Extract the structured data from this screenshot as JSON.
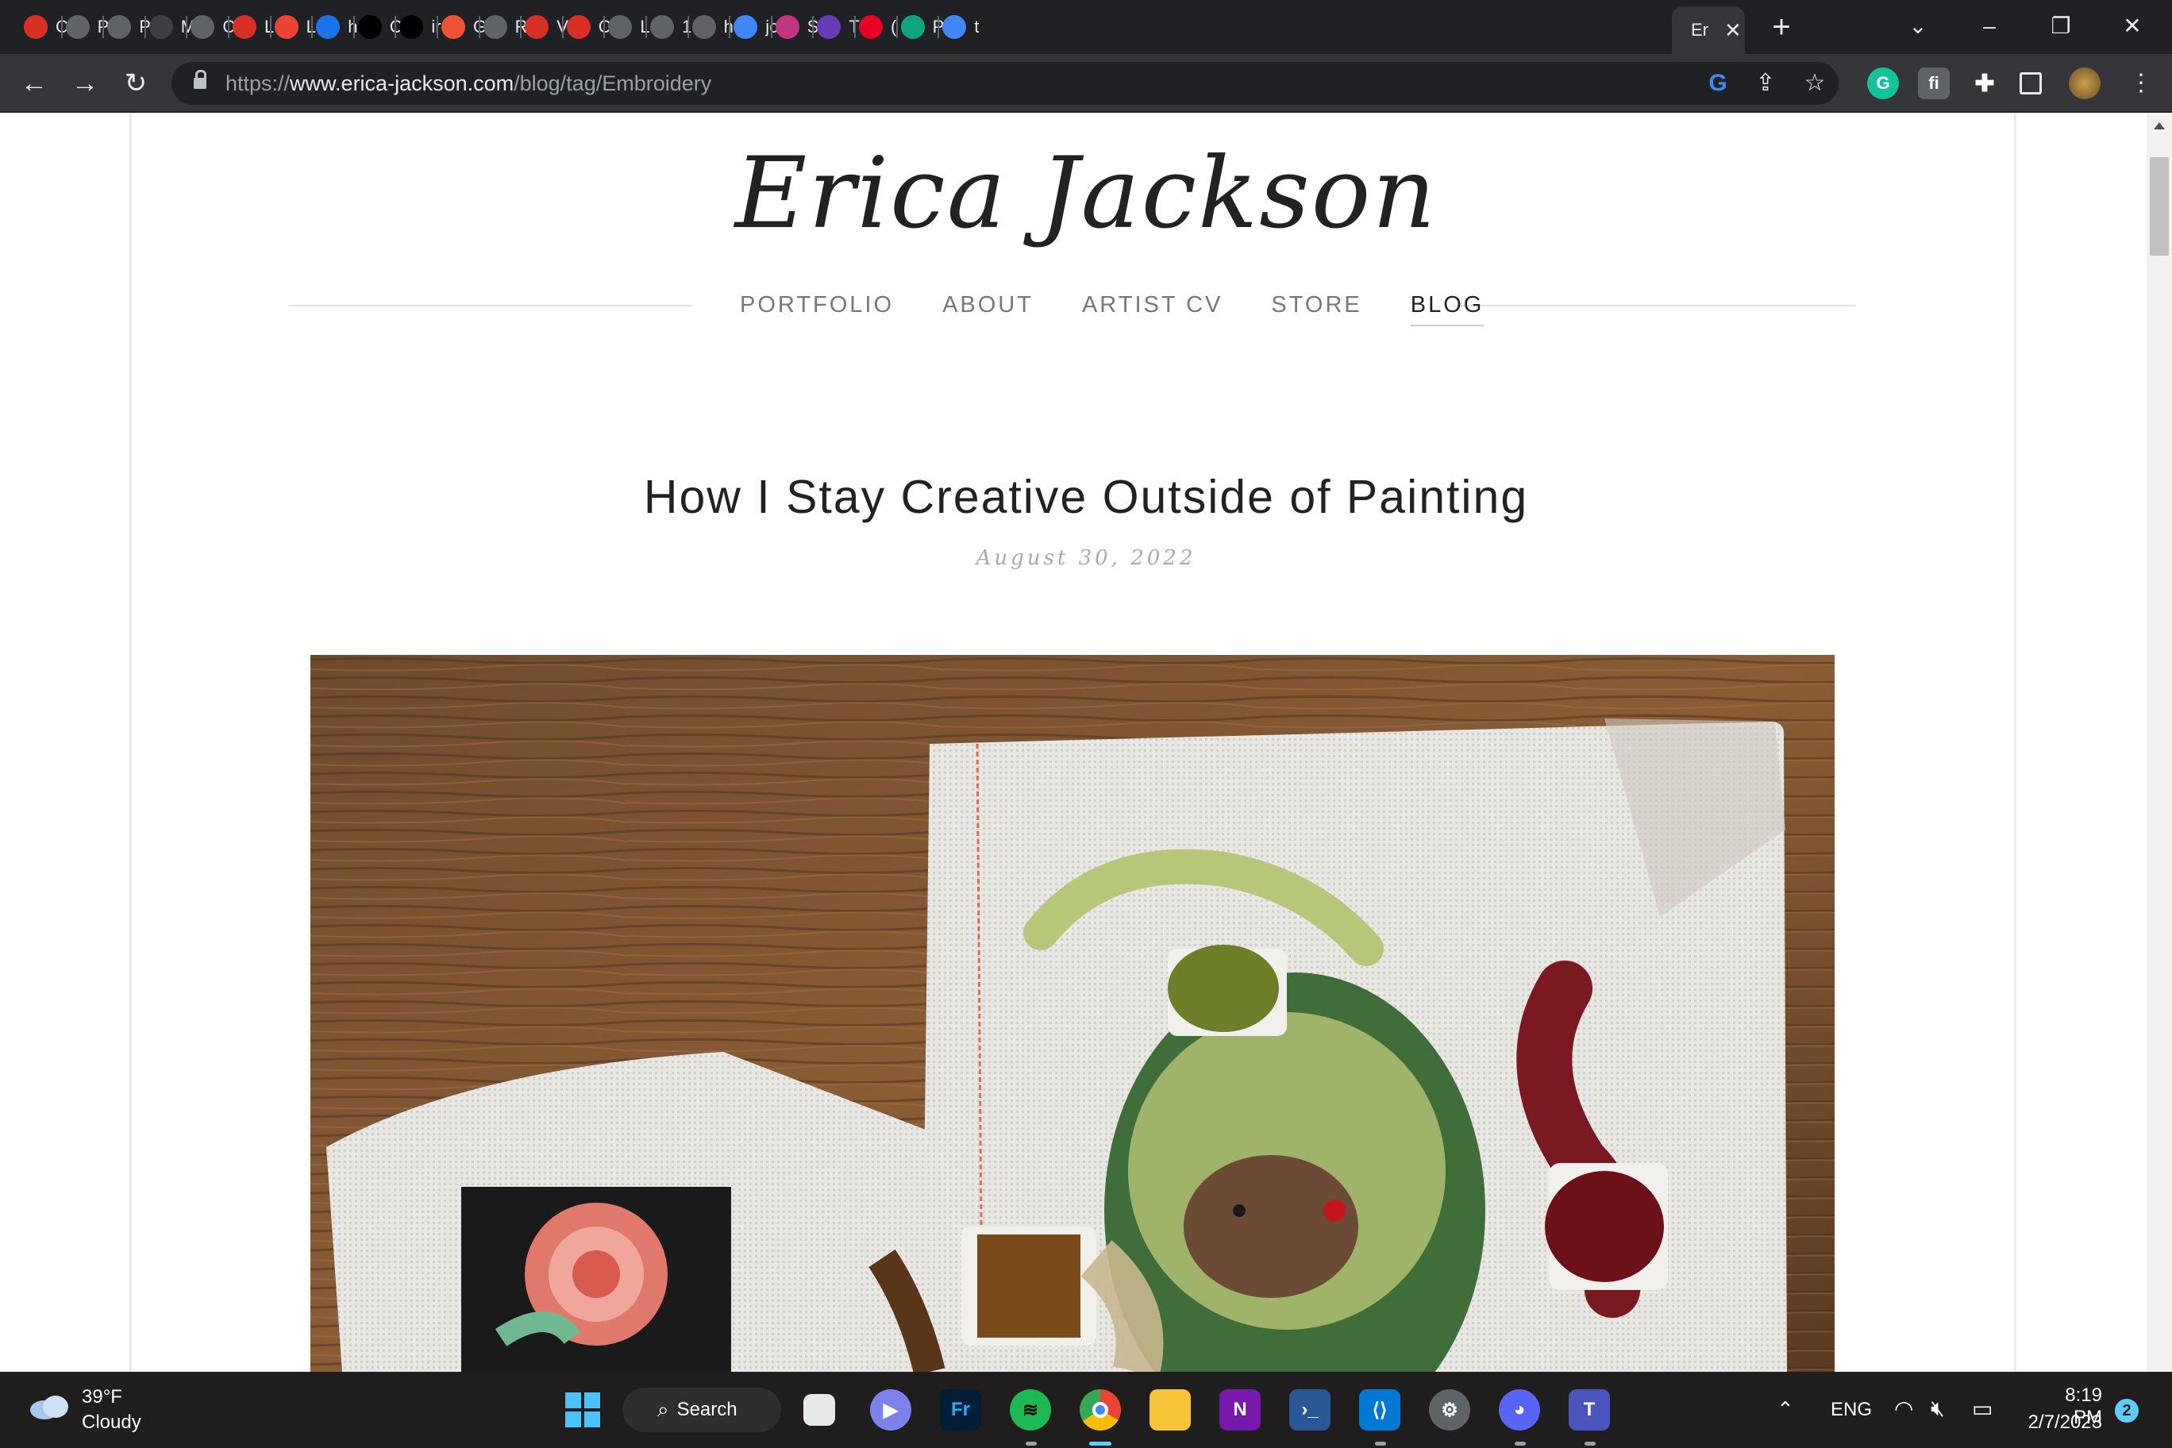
{
  "browser": {
    "tabs": [
      {
        "label": "C",
        "icon": "shield-icon",
        "color": "#d93025"
      },
      {
        "label": "P",
        "icon": "globe-icon",
        "color": "#5f6368"
      },
      {
        "label": "P",
        "icon": "globe-icon",
        "color": "#5f6368"
      },
      {
        "label": "M",
        "icon": "m4-icon",
        "color": "#3c4043"
      },
      {
        "label": "C",
        "icon": "globe-icon",
        "color": "#5f6368"
      },
      {
        "label": "L",
        "icon": "shield-icon",
        "color": "#d93025"
      },
      {
        "label": "L",
        "icon": "gmail-icon",
        "color": "#ea4335"
      },
      {
        "label": "h",
        "icon": "xm-icon",
        "color": "#1a73e8"
      },
      {
        "label": "C",
        "icon": "github-icon",
        "color": "#000000"
      },
      {
        "label": "ir",
        "icon": "github-icon",
        "color": "#000000"
      },
      {
        "label": "G",
        "icon": "git-icon",
        "color": "#f05133"
      },
      {
        "label": "R",
        "icon": "globe-icon",
        "color": "#5f6368"
      },
      {
        "label": "V",
        "icon": "shield-icon",
        "color": "#d93025"
      },
      {
        "label": "C",
        "icon": "shield-icon",
        "color": "#d93025"
      },
      {
        "label": "L",
        "icon": "globe-icon",
        "color": "#5f6368"
      },
      {
        "label": "1",
        "icon": "globe-icon",
        "color": "#5f6368"
      },
      {
        "label": "h",
        "icon": "globe-icon",
        "color": "#5f6368"
      },
      {
        "label": "jc",
        "icon": "google-icon",
        "color": "#4285f4"
      },
      {
        "label": "S",
        "icon": "instagram-icon",
        "color": "#c13584"
      },
      {
        "label": "T",
        "icon": "list-icon",
        "color": "#673ab7"
      },
      {
        "label": "(",
        "icon": "pinterest-icon",
        "color": "#e60023"
      },
      {
        "label": "P",
        "icon": "openai-icon",
        "color": "#10a37f"
      },
      {
        "label": "t",
        "icon": "docs-icon",
        "color": "#4285f4"
      }
    ],
    "active_tab": {
      "label": "Er"
    },
    "url_prefix": "https://",
    "url_host": "www.erica-jackson.com",
    "url_path": "/blog/tag/Embroidery"
  },
  "site": {
    "logo": "Erica Jackson",
    "nav": [
      "PORTFOLIO",
      "ABOUT",
      "ARTIST CV",
      "STORE",
      "BLOG"
    ],
    "active_nav": "BLOG"
  },
  "post": {
    "title": "How I Stay Creative Outside of Painting",
    "date": "August 30, 2022",
    "image_alt": "Needlepoint canvases with a rose and a mouse design, surrounded by skeins of green, brown and red thread on a wooden table"
  },
  "taskbar": {
    "weather_temp": "39°F",
    "weather_cond": "Cloudy",
    "search_label": "Search",
    "language": "ENG",
    "time": "8:19 PM",
    "date": "2/7/2023",
    "notification_count": "2"
  }
}
